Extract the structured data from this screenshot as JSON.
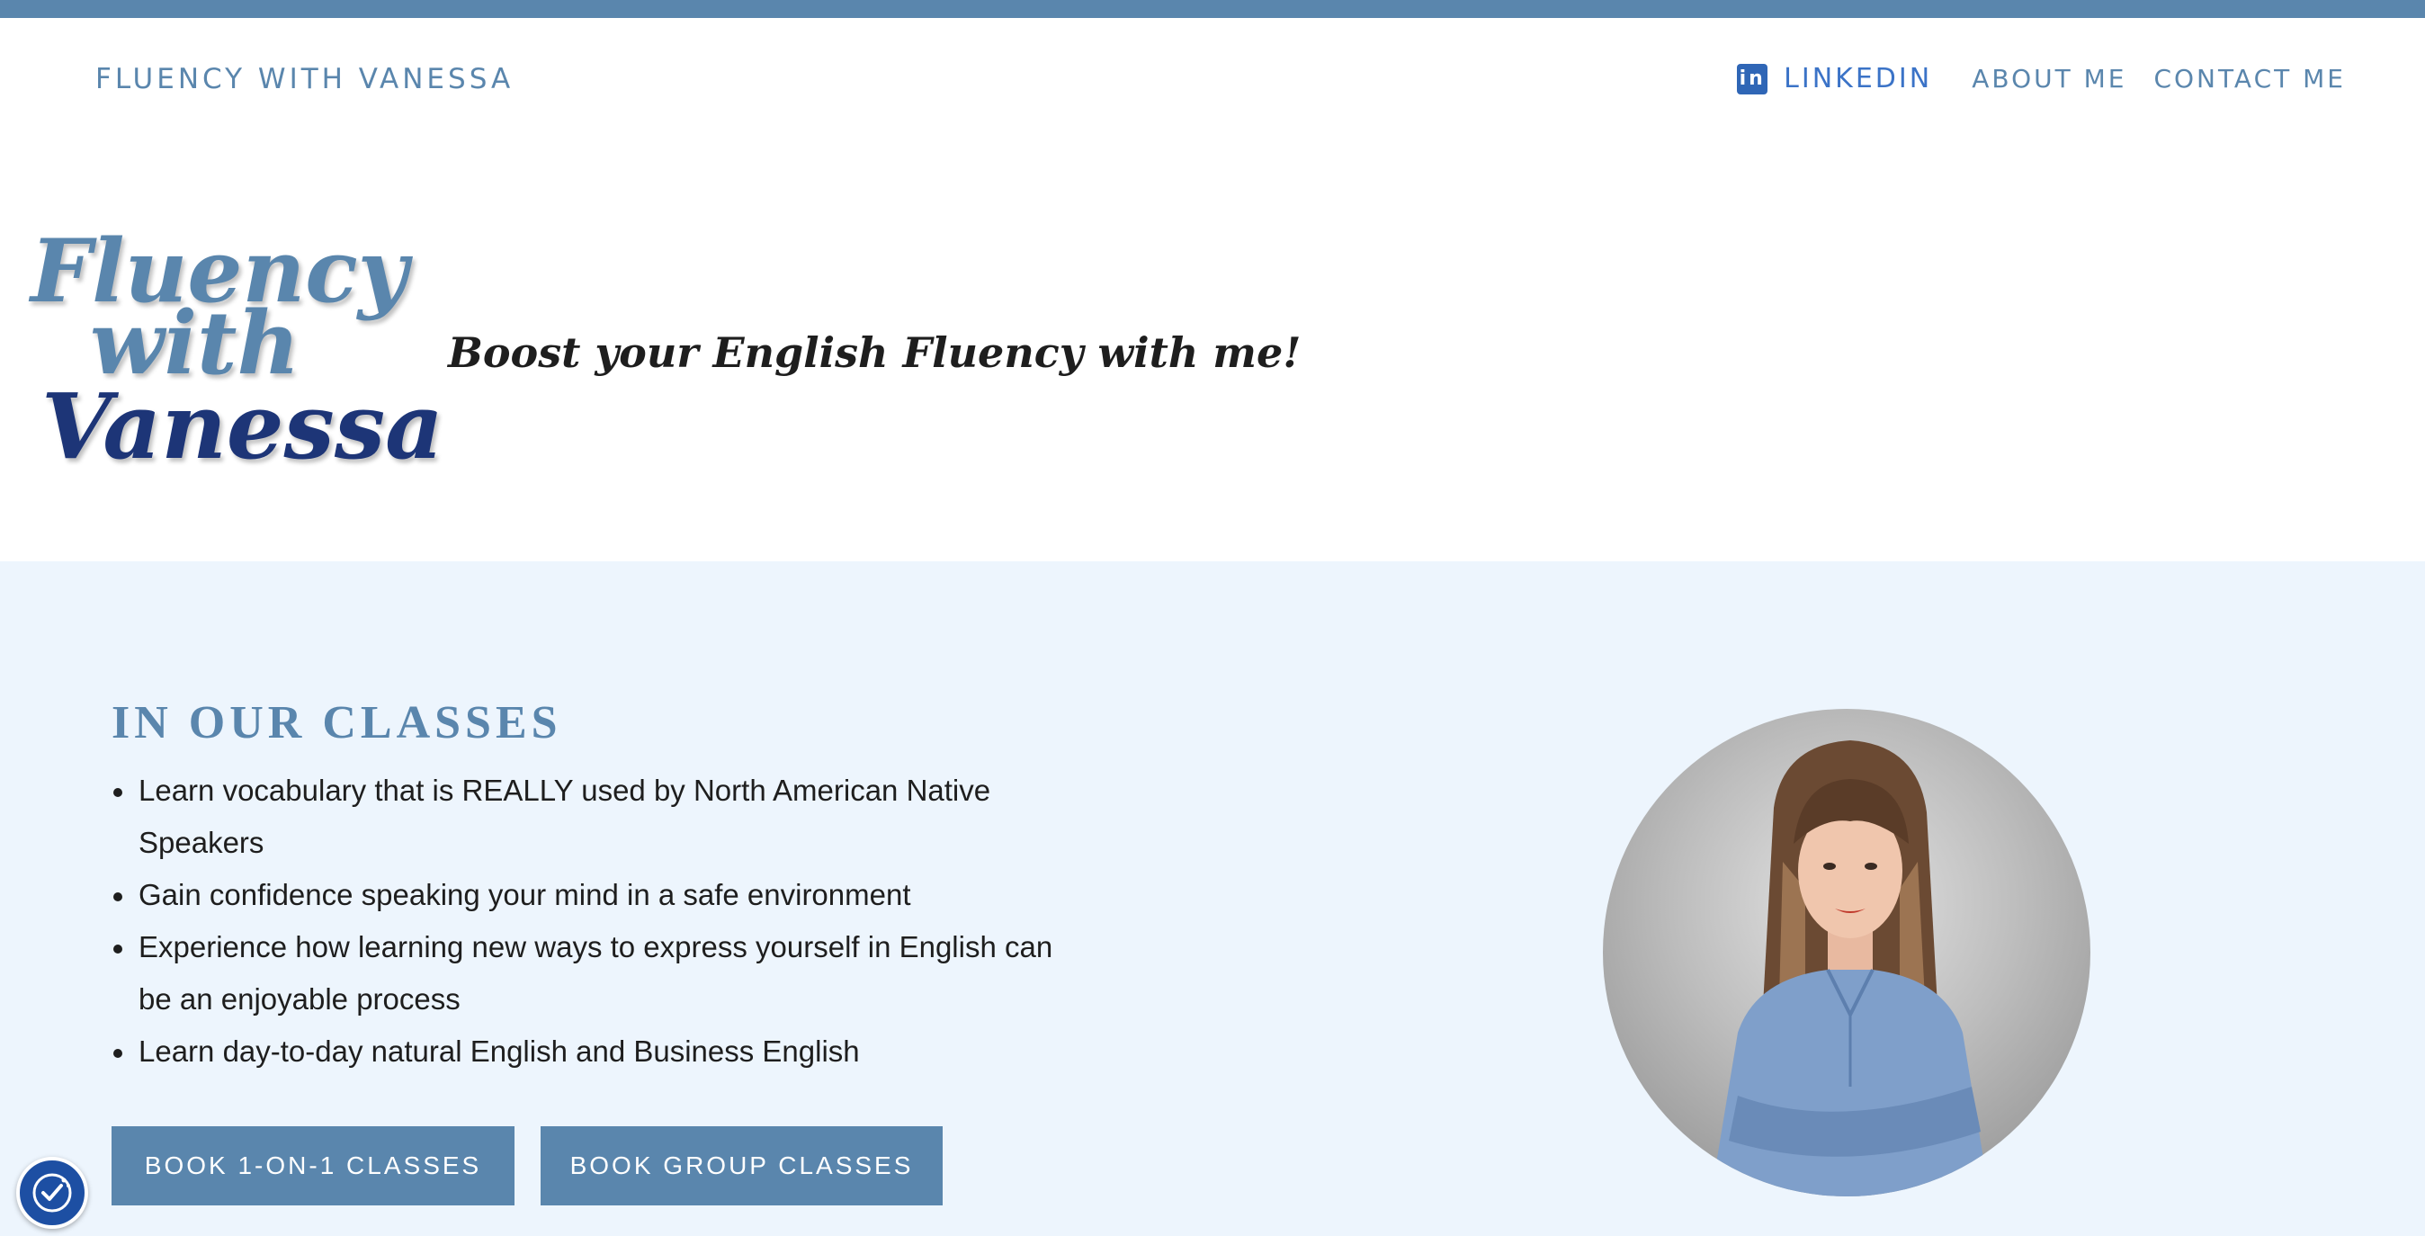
{
  "header": {
    "site_title": "FLUENCY WITH VANESSA",
    "nav": {
      "linkedin": "LINKEDIN",
      "about": "ABOUT ME",
      "contact": "CONTACT ME"
    },
    "linkedin_icon_glyph": "in"
  },
  "hero": {
    "logo_lines": [
      "Fluency",
      "with",
      "Vanessa"
    ],
    "tagline": "Boost your English Fluency with me!"
  },
  "classes": {
    "title": "IN OUR CLASSES",
    "bullets": [
      "Learn vocabulary that is REALLY used by North American Native Speakers",
      "Gain confidence speaking your mind in a safe environment",
      "Experience how learning new ways to express yourself in English can be an enjoyable process",
      "Learn day-to-day natural English and Business English"
    ],
    "buttons": {
      "one_on_one": "BOOK 1-ON-1 CLASSES",
      "group": "BOOK GROUP CLASSES"
    }
  },
  "colors": {
    "accent": "#5a86ad",
    "logo_dark": "#1d3577",
    "section_bg": "#edf5fd",
    "linkedin": "#2f66b6"
  }
}
